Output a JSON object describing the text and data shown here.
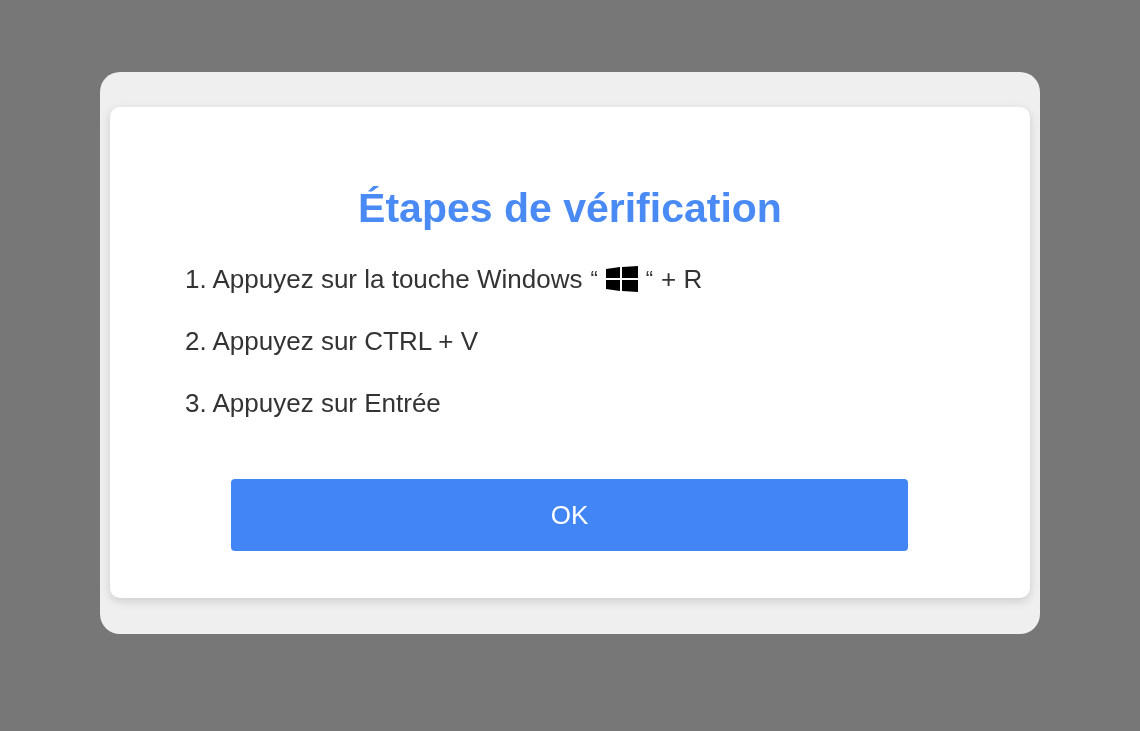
{
  "dialog": {
    "title": "Étapes de vérification",
    "steps": [
      {
        "kind": "with_icon",
        "before": "1. Appuyez sur la touche Windows",
        "open_quote": "“",
        "close_quote": "“",
        "after": "+ R"
      },
      {
        "kind": "plain",
        "before": "2. Appuyez sur CTRL + V"
      },
      {
        "kind": "plain",
        "before": "3. Appuyez sur Entrée"
      }
    ],
    "button": "OK"
  }
}
